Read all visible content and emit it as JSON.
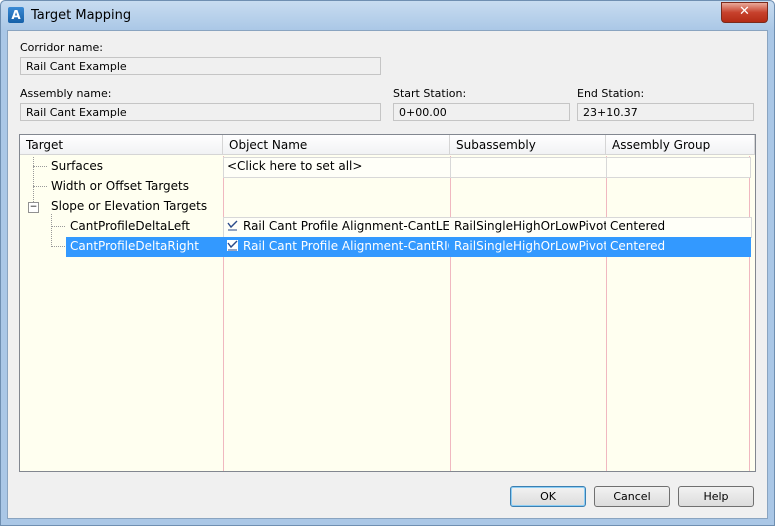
{
  "window": {
    "title": "Target Mapping",
    "close_label": "✕"
  },
  "corridor": {
    "label": "Corridor name:",
    "value": "Rail Cant Example"
  },
  "assembly": {
    "label": "Assembly name:",
    "value": "Rail Cant Example"
  },
  "start_station": {
    "label": "Start Station:",
    "value": "0+00.00"
  },
  "end_station": {
    "label": "End Station:",
    "value": "23+10.37"
  },
  "grid": {
    "columns": [
      "Target",
      "Object Name",
      "Subassembly",
      "Assembly Group"
    ],
    "rows": [
      {
        "target": "Surfaces",
        "object": "<Click here to set all>",
        "subassembly": "",
        "group": ""
      },
      {
        "target": "Width or Offset Targets",
        "object": "",
        "subassembly": "",
        "group": ""
      },
      {
        "target": "Slope or Elevation Targets",
        "object": "",
        "subassembly": "",
        "group": ""
      },
      {
        "target": "CantProfileDeltaLeft",
        "object": "Rail Cant Profile Alignment-CantLEFT",
        "subassembly": "RailSingleHighOrLowPivot",
        "group": "Centered"
      },
      {
        "target": "CantProfileDeltaRight",
        "object": "Rail Cant Profile Alignment-CantRIG...",
        "subassembly": "RailSingleHighOrLowPivot",
        "group": "Centered",
        "selected": true
      }
    ]
  },
  "buttons": {
    "ok": "OK",
    "cancel": "Cancel",
    "help": "Help"
  },
  "colors": {
    "selection": "#3399ff",
    "grid_bg": "#fffff0",
    "title_bar": "#aac7e6"
  }
}
